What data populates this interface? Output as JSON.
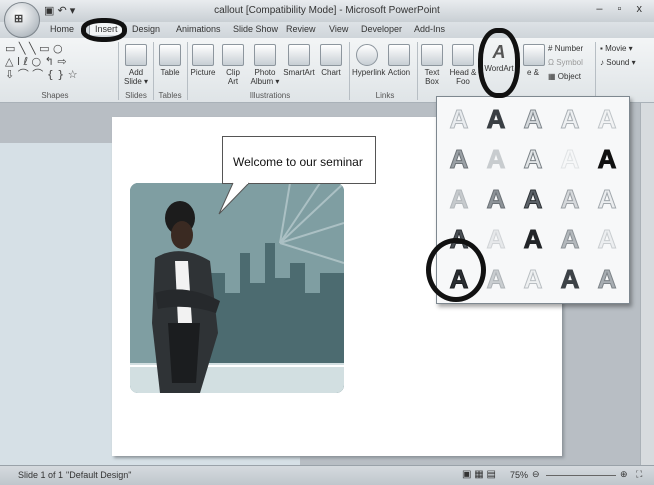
{
  "window": {
    "title": "callout [Compatibility Mode] - Microsoft PowerPoint",
    "office_button_label": "⊞",
    "qat": "▣ ↶ ▾",
    "controls": "– ▫ x"
  },
  "tabs": [
    "Home",
    "Insert",
    "Design",
    "Animations",
    "Slide Show",
    "Review",
    "View",
    "Developer",
    "Add-Ins"
  ],
  "active_tab": "Insert",
  "ribbon": {
    "groups": [
      {
        "label": "Shapes"
      },
      {
        "label": "Slides"
      },
      {
        "label": "Tables"
      },
      {
        "label": "Illustrations"
      },
      {
        "label": "Links"
      }
    ],
    "shapes_glyphs": [
      "▭ ╲ ╲ ▭ ○",
      "△ l ℓ ○ ↰ ⇨",
      "⇩ ⌒ ⌒ { } ☆"
    ],
    "buttons": [
      {
        "label": "Add Slide ▾",
        "name": "add-slide-button"
      },
      {
        "label": "Table",
        "name": "table-button"
      },
      {
        "label": "Picture",
        "name": "picture-button"
      },
      {
        "label": "Clip Art",
        "name": "clip-art-button"
      },
      {
        "label": "Photo Album ▾",
        "name": "photo-album-button"
      },
      {
        "label": "SmartArt",
        "name": "smartart-button"
      },
      {
        "label": "Chart",
        "name": "chart-button"
      },
      {
        "label": "Hyperlink",
        "name": "hyperlink-button"
      },
      {
        "label": "Action",
        "name": "action-button"
      },
      {
        "label": "Text Box",
        "name": "text-box-button"
      },
      {
        "label": "Head & Foo",
        "name": "header-footer-button"
      },
      {
        "label": "WordArt",
        "name": "wordart-button"
      },
      {
        "label": "e &",
        "name": "date-time-button"
      }
    ],
    "right_items": [
      {
        "label": "Number",
        "name": "slide-number-button"
      },
      {
        "label": "Symbol",
        "name": "symbol-button"
      },
      {
        "label": "Object",
        "name": "object-button"
      },
      {
        "label": "Movie ▾",
        "name": "movie-button"
      },
      {
        "label": "Sound ▾",
        "name": "sound-button"
      }
    ]
  },
  "slide": {
    "callout_text": "Welcome to our seminar"
  },
  "wordart_gallery": {
    "glyph": "A",
    "rows": [
      [
        {
          "color": "#e9ecef",
          "stroke": "#b0b6bb"
        },
        {
          "color": "#3a3f44",
          "stroke": "#3a3f44"
        },
        {
          "color": "#d6dadd",
          "stroke": "#7f868c"
        },
        {
          "color": "#eef0f2",
          "stroke": "#aab0b5"
        },
        {
          "color": "#f2f3f4",
          "stroke": "#bfc4c8"
        }
      ],
      [
        {
          "color": "#9aa0a5",
          "stroke": "#6c7277"
        },
        {
          "color": "#c8cccf",
          "stroke": "#c8cccf"
        },
        {
          "color": "#e2e5e7",
          "stroke": "#7a8186"
        },
        {
          "color": "#f6f7f8",
          "stroke": "#e0e3e5"
        },
        {
          "color": "#111111",
          "stroke": "#111111"
        }
      ],
      [
        {
          "color": "#c6cacd",
          "stroke": "#b3b8bc"
        },
        {
          "color": "#8d9398",
          "stroke": "#6b7176"
        },
        {
          "color": "#5c6268",
          "stroke": "#2e3337"
        },
        {
          "color": "#d5d8db",
          "stroke": "#9a9fa4"
        },
        {
          "color": "#ebedef",
          "stroke": "#a2a8ad"
        }
      ],
      [
        {
          "color": "#4b5055",
          "stroke": "#2d3135"
        },
        {
          "color": "#e6e8ea",
          "stroke": "#d0d3d6"
        },
        {
          "color": "#222528",
          "stroke": "#222528"
        },
        {
          "color": "#b3b8bc",
          "stroke": "#8c9297"
        },
        {
          "color": "#eceef0",
          "stroke": "#c9cdd0"
        }
      ],
      [
        {
          "color": "#2b2f33",
          "stroke": "#1a1d20"
        },
        {
          "color": "#c9cdd0",
          "stroke": "#aeb3b7"
        },
        {
          "color": "#eef0f1",
          "stroke": "#b9bec2"
        },
        {
          "color": "#3d4247",
          "stroke": "#3d4247"
        },
        {
          "color": "#a7adb2",
          "stroke": "#7d8388"
        }
      ]
    ]
  },
  "status": {
    "slide_info": "Slide 1 of 1",
    "theme": "\"Default Design\"",
    "zoom": "75%"
  },
  "colors": {
    "marker": "#111111",
    "illustration_bg": "#6e8f93"
  }
}
